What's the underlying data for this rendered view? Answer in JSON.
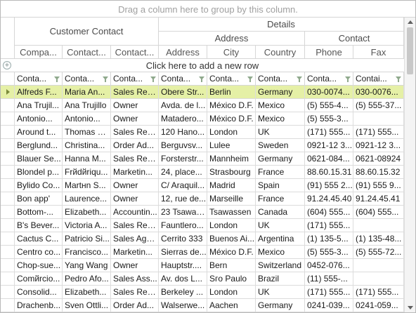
{
  "group_panel": {
    "text": "Drag a column here to group by this column."
  },
  "header": {
    "customer_contact": "Customer Contact",
    "details": "Details",
    "address_group": "Address",
    "contact_group": "Contact",
    "columns": [
      "Compa...",
      "Contact...",
      "Contact...",
      "Address",
      "City",
      "Country",
      "Phone",
      "Fax"
    ]
  },
  "new_row": {
    "text": "Click here to add a new row"
  },
  "filters": [
    "Conta...",
    "Conta...",
    "Conta...",
    "Conta...",
    "Conta...",
    "Conta...",
    "Conta...",
    "Contai..."
  ],
  "rows": [
    [
      "Alfreds F...",
      "Maria An...",
      "Sales Rep...",
      "Obere Str...",
      "Berlin",
      "Germany",
      "030-0074...",
      "030-0076..."
    ],
    [
      "Ana Trujil...",
      "Ana Trujillo",
      "Owner",
      "Avda. de l...",
      "Мéхico D.F.",
      "Mexico",
      "(5) 555-4...",
      "(5) 555-37..."
    ],
    [
      "Antonio...",
      "Antonio...",
      "Owner",
      "Matadero...",
      "Мéхico D.F.",
      "Mexico",
      "(5) 555-3...",
      ""
    ],
    [
      "Around t...",
      "Thomas H...",
      "Sales Rep...",
      "120 Hano...",
      "London",
      "UK",
      "(171) 555...",
      "(171) 555..."
    ],
    [
      "Berglund...",
      "Christina...",
      "Order Ad...",
      "Berguvsv...",
      "Lulee",
      "Sweden",
      "0921-12 3...",
      "0921-12 3..."
    ],
    [
      "Blauer Se...",
      "Hanna M...",
      "Sales Rep...",
      "Forsterstr...",
      "Mannheim",
      "Germany",
      "0621-084...",
      "0621-08924"
    ],
    [
      "Blondel p...",
      "Frйdйriqu...",
      "Marketin...",
      "24, place...",
      "Strasbourg",
      "France",
      "88.60.15.31",
      "88.60.15.32"
    ],
    [
      "Bylido Co...",
      "Martнn S...",
      "Owner",
      "C/ Araquil...",
      "Madrid",
      "Spain",
      "(91) 555 2...",
      "(91) 555 9..."
    ],
    [
      "Bon app'",
      "Laurence...",
      "Owner",
      "12, rue de...",
      "Marseille",
      "France",
      "91.24.45.40",
      "91.24.45.41"
    ],
    [
      "Bottom-...",
      "Elizabeth...",
      "Accountin...",
      "23 Tsawas...",
      "Tsawassen",
      "Canada",
      "(604) 555...",
      "(604) 555..."
    ],
    [
      "B's Bever...",
      "Victoria A...",
      "Sales Rep...",
      "Fauntlero...",
      "London",
      "UK",
      "(171) 555...",
      ""
    ],
    [
      "Cactus C...",
      "Patricio Si...",
      "Sales Agent",
      "Cerrito 333",
      "Buenos Ai...",
      "Argentina",
      "(1) 135-5...",
      "(1) 135-48..."
    ],
    [
      "Centro co...",
      "Francisco...",
      "Marketin...",
      "Sierras de...",
      "Мéхico D.F.",
      "Mexico",
      "(5) 555-3...",
      "(5) 555-72..."
    ],
    [
      "Chop-sue...",
      "Yang Wang",
      "Owner",
      "Hauptstr....",
      "Bern",
      "Switzerland",
      "0452-076...",
      ""
    ],
    [
      "Comйrcio...",
      "Pedro Afo...",
      "Sales Ass...",
      "Av. dos L...",
      "Sгo Paulo",
      "Brazil",
      "(11) 555-...",
      ""
    ],
    [
      "Consolid...",
      "Elizabeth...",
      "Sales Rep...",
      "Berkeley ...",
      "London",
      "UK",
      "(171) 555...",
      "(171) 555..."
    ],
    [
      "Drachenb...",
      "Sven Ottli...",
      "Order Ad...",
      "Walserwe...",
      "Aachen",
      "Germany",
      "0241-039...",
      "0241-059..."
    ]
  ],
  "colors": {
    "current_row": "#e5f0a6",
    "filter_icon": "#8fa98c"
  }
}
